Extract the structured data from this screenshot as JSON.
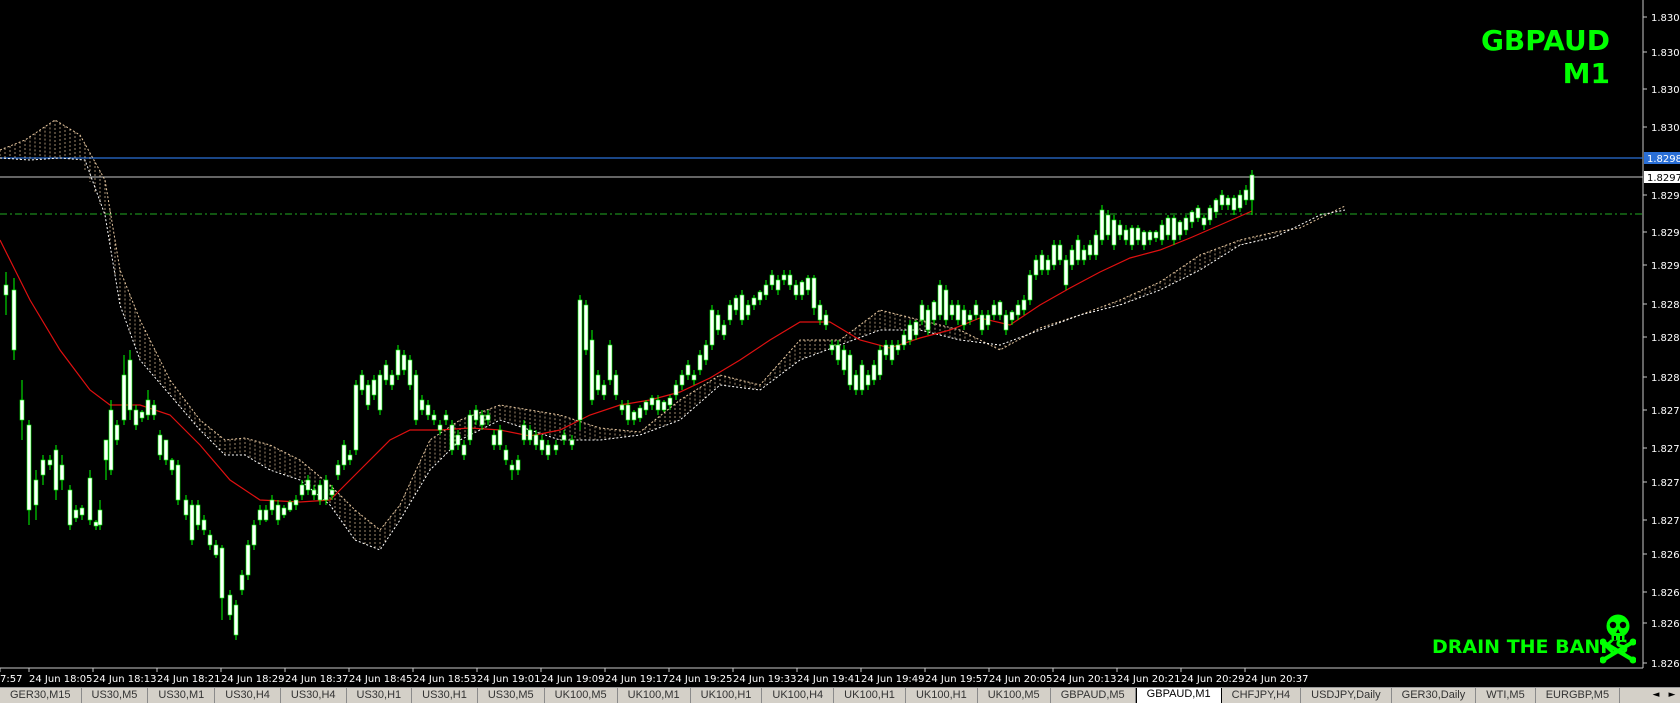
{
  "chart": {
    "symbol_title": "GBPAUD M1",
    "watermark": "DRAIN THE BANKS",
    "skull_icon": "skull-crossbones-icon",
    "colors": {
      "background": "#000000",
      "bull_candle": "#ffffff",
      "candle_wick": "#00ff00",
      "ma_line": "#e01010",
      "cloud": "#e8c8a0",
      "bid_line": "#2a6fd6",
      "ask_line": "#c8c8c8",
      "dashed_level": "#22aa22",
      "text_green": "#00ff00"
    },
    "price_axis": [
      "1.83095",
      "1.83065",
      "1.83040",
      "1.83010",
      "1.82960",
      "1.82930",
      "1.82905",
      "1.82875",
      "1.82850",
      "1.82820",
      "1.82795",
      "1.82765",
      "1.82740",
      "1.82710",
      "1.82685",
      "1.82655",
      "1.82635",
      "1.82605"
    ],
    "price_markers": {
      "bid": "1.82987",
      "ask": "1.82972"
    },
    "time_axis": [
      "7:57",
      "24 Jun 18:05",
      "24 Jun 18:13",
      "24 Jun 18:21",
      "24 Jun 18:29",
      "24 Jun 18:37",
      "24 Jun 18:45",
      "24 Jun 18:53",
      "24 Jun 19:01",
      "24 Jun 19:09",
      "24 Jun 19:17",
      "24 Jun 19:25",
      "24 Jun 19:33",
      "24 Jun 19:41",
      "24 Jun 19:49",
      "24 Jun 19:57",
      "24 Jun 20:05",
      "24 Jun 20:13",
      "24 Jun 20:21",
      "24 Jun 20:29",
      "24 Jun 20:37"
    ]
  },
  "tabs": [
    {
      "label": "GER30,M15",
      "active": false
    },
    {
      "label": "US30,M5",
      "active": false
    },
    {
      "label": "US30,M1",
      "active": false
    },
    {
      "label": "US30,H4",
      "active": false
    },
    {
      "label": "US30,H4",
      "active": false
    },
    {
      "label": "US30,H1",
      "active": false
    },
    {
      "label": "US30,H1",
      "active": false
    },
    {
      "label": "US30,M5",
      "active": false
    },
    {
      "label": "UK100,M5",
      "active": false
    },
    {
      "label": "UK100,M1",
      "active": false
    },
    {
      "label": "UK100,H1",
      "active": false
    },
    {
      "label": "UK100,H4",
      "active": false
    },
    {
      "label": "UK100,H1",
      "active": false
    },
    {
      "label": "UK100,H1",
      "active": false
    },
    {
      "label": "UK100,M5",
      "active": false
    },
    {
      "label": "GBPAUD,M5",
      "active": false
    },
    {
      "label": "GBPAUD,M1",
      "active": true
    },
    {
      "label": "CHFJPY,H4",
      "active": false
    },
    {
      "label": "USDJPY,Daily",
      "active": false
    },
    {
      "label": "GER30,Daily",
      "active": false
    },
    {
      "label": "WTI,M5",
      "active": false
    },
    {
      "label": "EURGBP,M5",
      "active": false
    }
  ],
  "tab_nav": {
    "left": "◄",
    "right": "►"
  }
}
